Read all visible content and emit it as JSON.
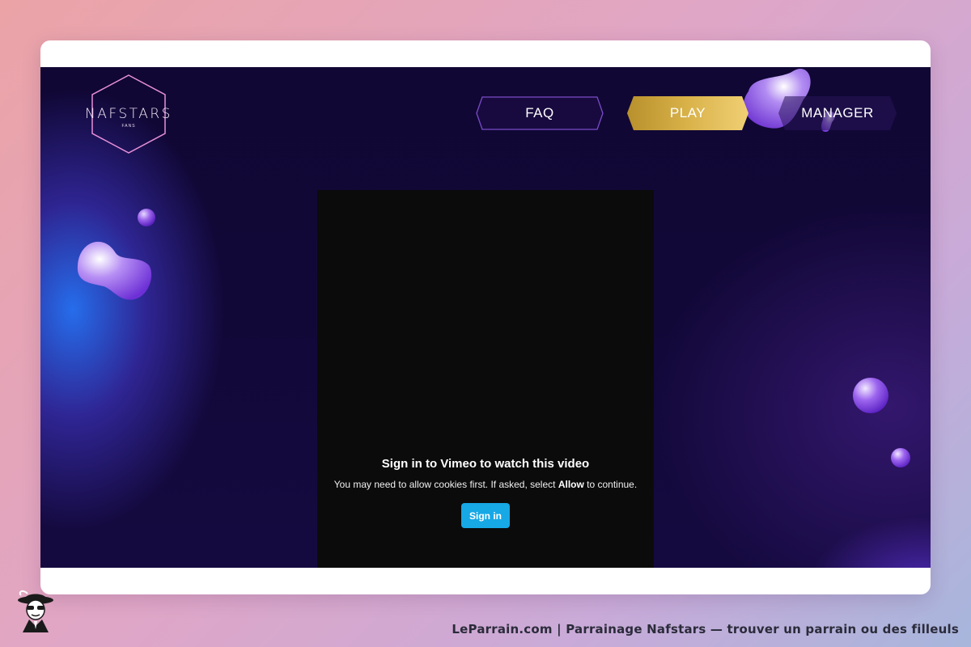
{
  "logo": {
    "text": "NAFSTARS",
    "subtext": "FANS"
  },
  "nav": {
    "faq_label": "FAQ",
    "play_label": "PLAY",
    "manager_label": "MANAGER"
  },
  "video": {
    "title": "Sign in to Vimeo to watch this video",
    "message_before": "You may need to allow cookies first. If asked, select ",
    "message_bold": "Allow",
    "message_after": " to continue.",
    "signin_label": "Sign in"
  },
  "footer": {
    "caption": "LeParrain.com | Parrainage Nafstars — trouver un parrain ou des filleuls"
  },
  "colors": {
    "site_background": "#120838",
    "play_gold": "#d9b24a",
    "signin_blue": "#17a8e6",
    "faq_border": "#7a4cc8",
    "logo_pink": "#e890d8"
  },
  "icons": [
    "nafstars-hexagon-logo",
    "mascot-spy-icon"
  ]
}
